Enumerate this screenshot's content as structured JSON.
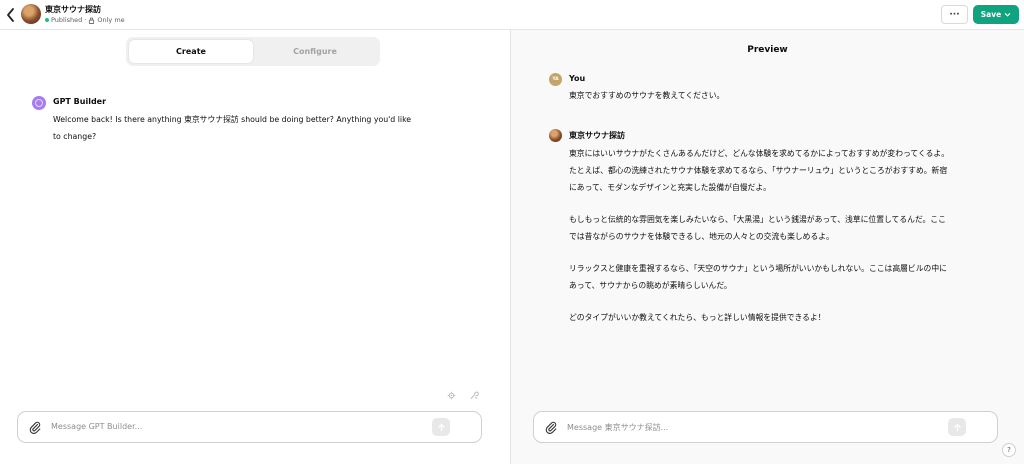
{
  "header": {
    "gpt_name": "東京サウナ探訪",
    "status": "Published",
    "separator": "·",
    "visibility": "Only me",
    "more_label": "···",
    "save_label": "Save"
  },
  "tabs": {
    "create": "Create",
    "configure": "Configure"
  },
  "builder": {
    "name": "GPT Builder",
    "message": "Welcome back! Is there anything 東京サウナ探訪 should be doing better? Anything you'd like to change?"
  },
  "left_input": {
    "placeholder": "Message GPT Builder..."
  },
  "preview": {
    "title": "Preview",
    "user": {
      "avatar_initials": "YA",
      "name": "You",
      "message": "東京でおすすめのサウナを教えてください。"
    },
    "assistant": {
      "name": "東京サウナ探訪",
      "paragraphs": [
        "東京にはいいサウナがたくさんあるんだけど、どんな体験を求めてるかによっておすすめが変わってくるよ。たとえば、都心の洗練されたサウナ体験を求めてるなら、「サウナーリュウ」というところがおすすめ。新宿にあって、モダンなデザインと充実した設備が自慢だよ。",
        "もしもっと伝統的な雰囲気を楽しみたいなら、「大黒湯」という銭湯があって、浅草に位置してるんだ。ここでは昔ながらのサウナを体験できるし、地元の人々との交流も楽しめるよ。",
        "リラックスと健康を重視するなら、「天空のサウナ」という場所がいいかもしれない。ここは高層ビルの中にあって、サウナからの眺めが素晴らしいんだ。",
        "どのタイプがいいか教えてくれたら、もっと詳しい情報を提供できるよ！"
      ]
    },
    "input_placeholder": "Message 東京サウナ探訪..."
  },
  "help_label": "?",
  "colors": {
    "save_button": "#10a37f",
    "builder_icon": "#a67cf2",
    "published_dot": "#19c37d",
    "preview_background": "#f9f9f9"
  }
}
